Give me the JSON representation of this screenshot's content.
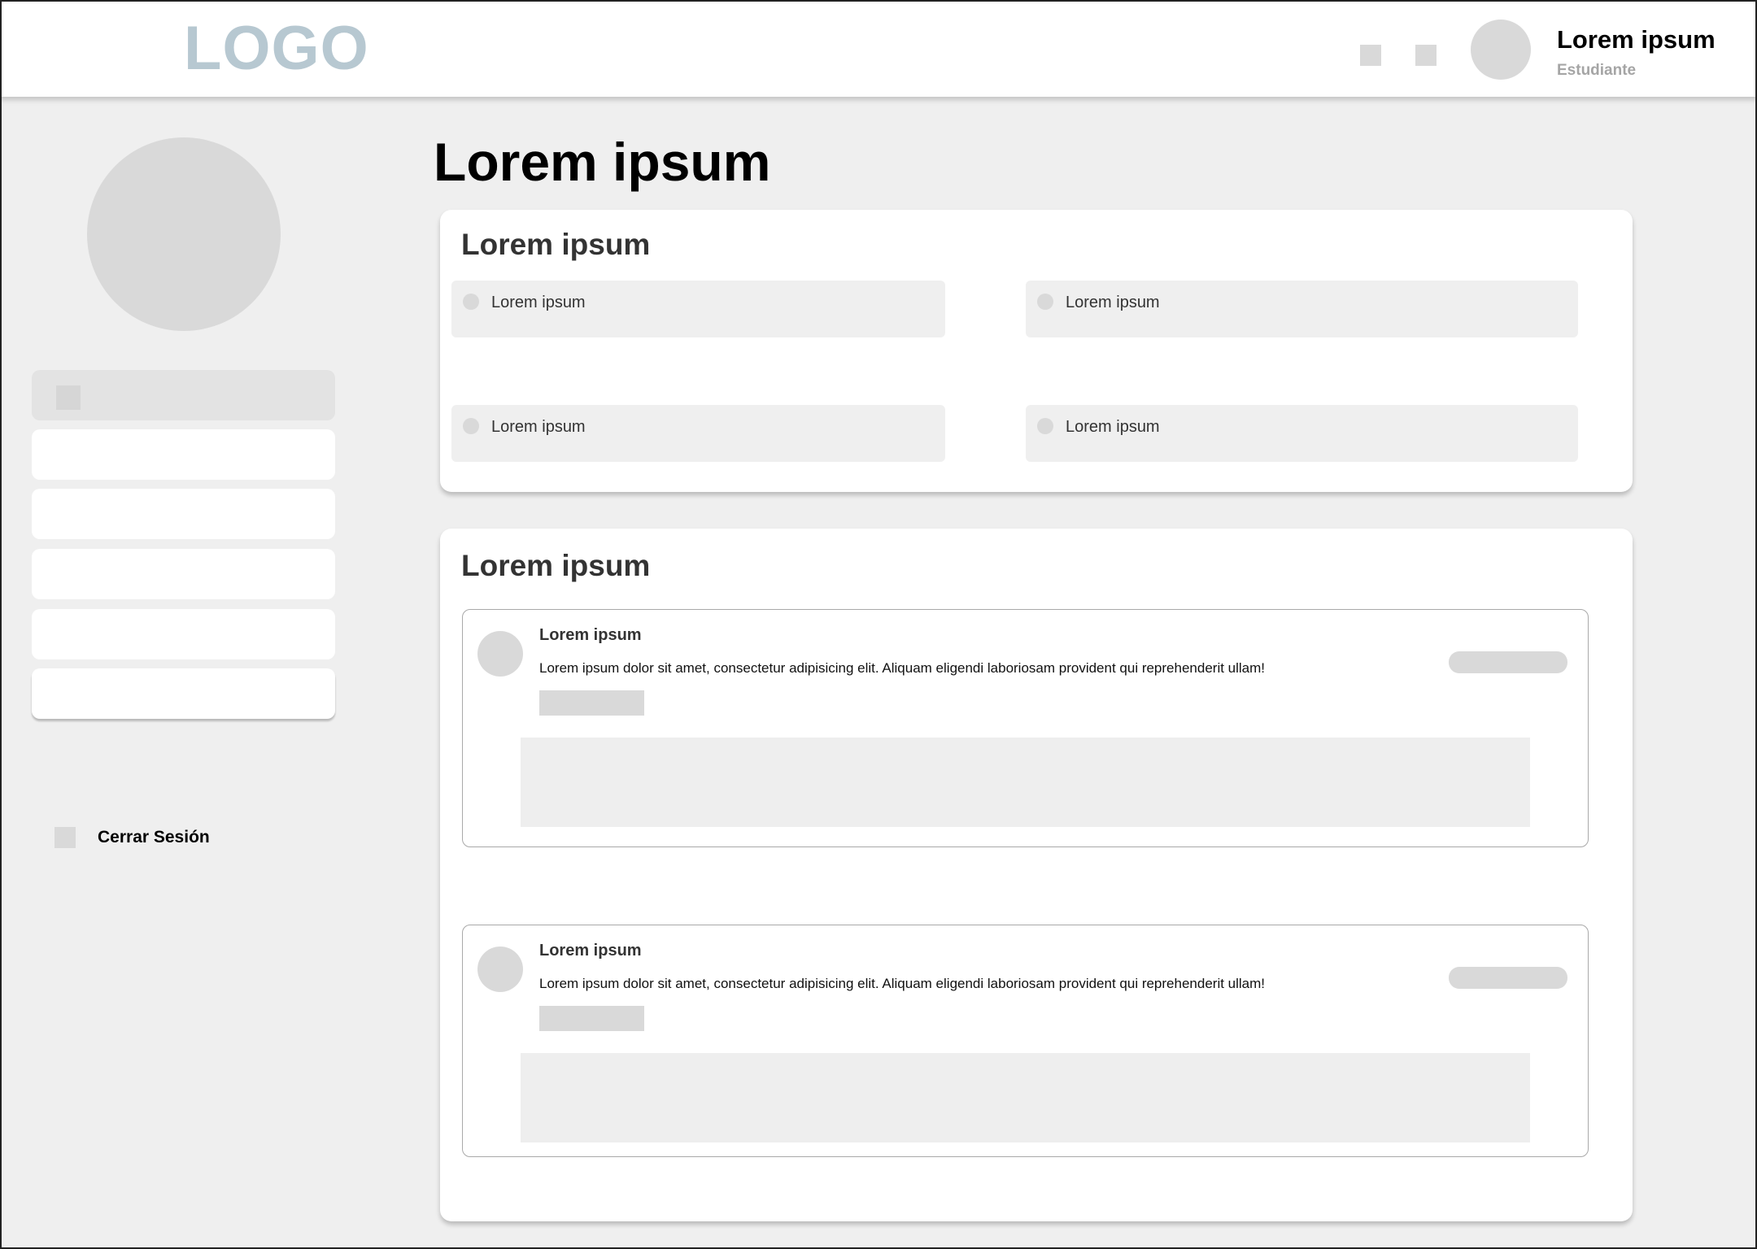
{
  "header": {
    "logo": "LOGO",
    "user_name": "Lorem ipsum",
    "user_role": "Estudiante"
  },
  "sidebar": {
    "items_count_note": "",
    "logout_label": "Cerrar Sesión"
  },
  "main": {
    "page_title": "Lorem ipsum",
    "options_card": {
      "title": "Lorem ipsum",
      "options": [
        {
          "label": "Lorem ipsum"
        },
        {
          "label": "Lorem ipsum"
        },
        {
          "label": "Lorem ipsum"
        },
        {
          "label": "Lorem ipsum"
        }
      ]
    },
    "posts_card": {
      "title": "Lorem ipsum",
      "posts": [
        {
          "title": "Lorem ipsum",
          "text": "Lorem ipsum dolor sit amet, consectetur adipisicing elit. Aliquam eligendi laboriosam provident qui reprehenderit ullam!"
        },
        {
          "title": "Lorem ipsum",
          "text": "Lorem ipsum dolor sit amet, consectetur adipisicing elit. Aliquam eligendi laboriosam provident qui reprehenderit ullam!"
        }
      ]
    }
  },
  "colors": {
    "logo": "#b7c8d1",
    "background": "#efefef",
    "placeholder": "#d9d9d9"
  }
}
